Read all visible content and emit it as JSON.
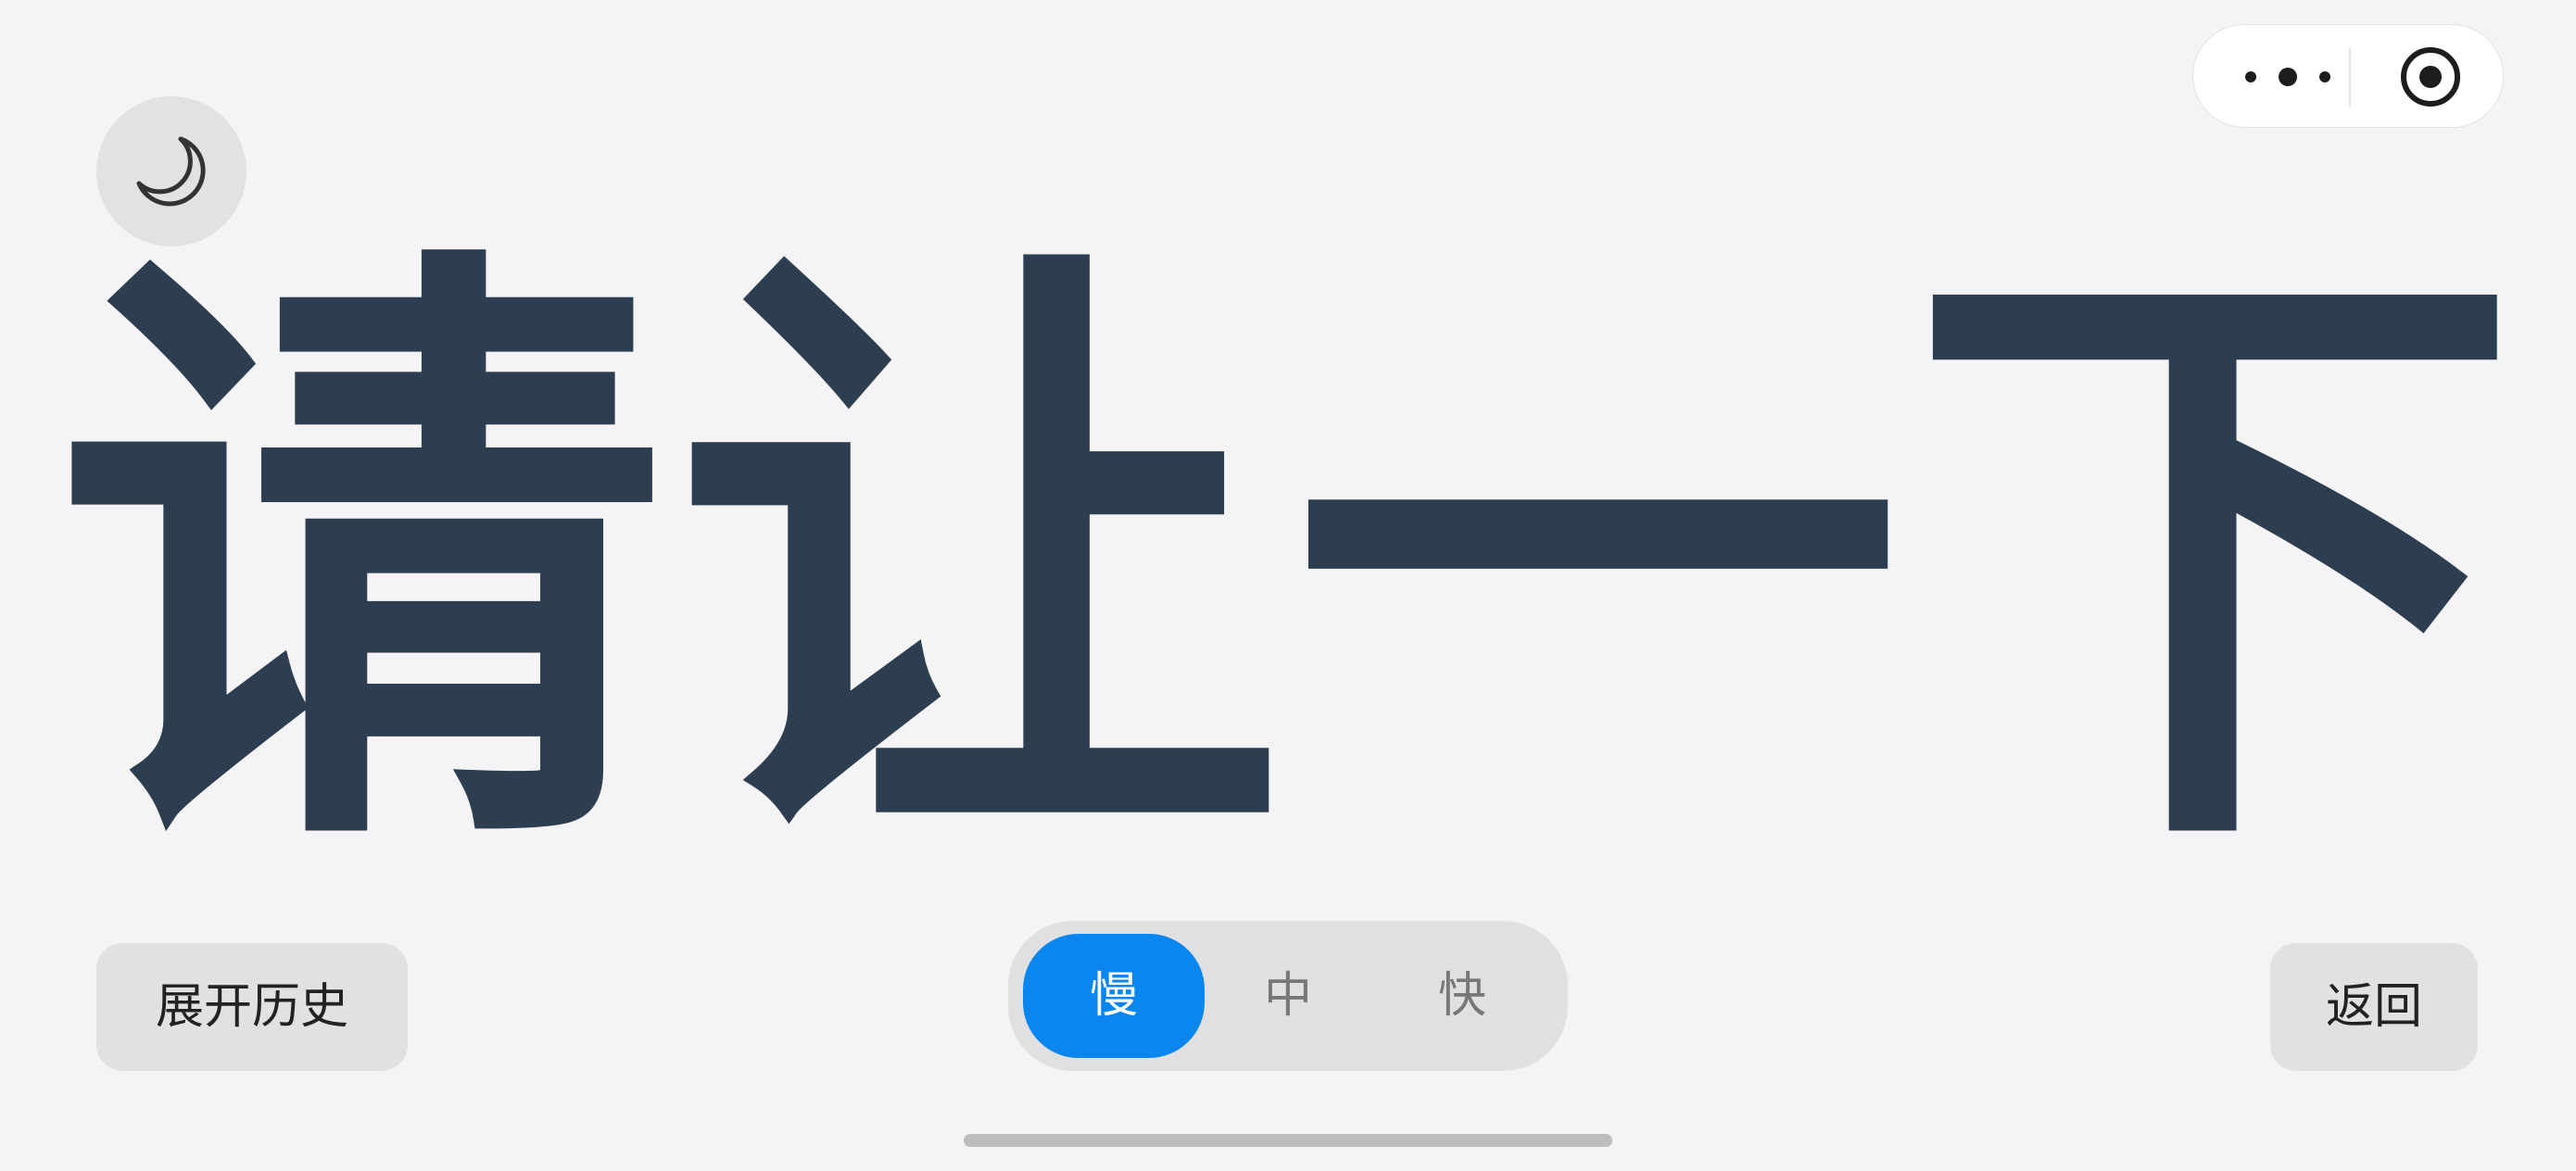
{
  "colors": {
    "text": "#2d3e50",
    "accent": "#0b86ee",
    "background": "#f4f4f6",
    "button_bg": "#e1e1e4"
  },
  "topbar": {
    "more_icon": "more-dots-icon",
    "target_icon": "target-icon"
  },
  "theme_toggle": {
    "icon": "moon-icon"
  },
  "display": {
    "chars": [
      "请",
      "让",
      "一",
      "下"
    ]
  },
  "history_button": {
    "label": "展开历史"
  },
  "speed": {
    "options": [
      "慢",
      "中",
      "快"
    ],
    "selected": "慢"
  },
  "back_button": {
    "label": "返回"
  }
}
